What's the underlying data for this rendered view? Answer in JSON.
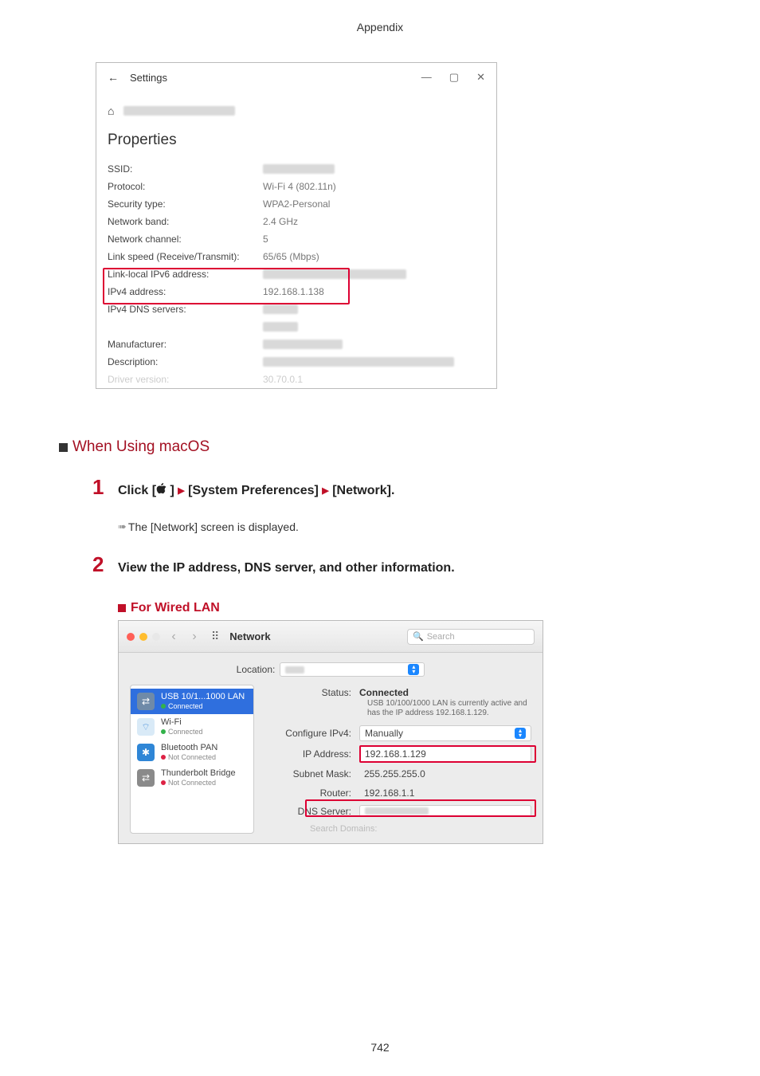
{
  "page": {
    "header": "Appendix",
    "number": "742"
  },
  "win": {
    "title": "Settings",
    "heading": "Properties",
    "rows": {
      "ssid": "SSID:",
      "protocol_l": "Protocol:",
      "protocol_v": "Wi-Fi 4 (802.11n)",
      "sec_l": "Security type:",
      "sec_v": "WPA2-Personal",
      "band_l": "Network band:",
      "band_v": "2.4 GHz",
      "chan_l": "Network channel:",
      "chan_v": "5",
      "link_l": "Link speed (Receive/Transmit):",
      "link_v": "65/65 (Mbps)",
      "llv6_l": "Link-local IPv6 address:",
      "ipv4_l": "IPv4 address:",
      "ipv4_v": "192.168.1.138",
      "dns_l": "IPv4 DNS servers:",
      "manu_l": "Manufacturer:",
      "desc_l": "Description:",
      "drv_l": "Driver version:",
      "drv_v": "30.70.0.1"
    }
  },
  "sections": {
    "macos_heading": "When Using macOS",
    "step1": {
      "pre": "Click [",
      "mid1": "[System Preferences]",
      "mid2": "[Network].",
      "close": "]"
    },
    "note1": "The [Network] screen is displayed.",
    "step2": "View the IP address, DNS server, and other information.",
    "wired_heading": "For Wired LAN"
  },
  "mac": {
    "title": "Network",
    "search_ph": "Search",
    "location_label": "Location:",
    "side": [
      {
        "name": "USB 10/1...1000 LAN",
        "sub": "Connected",
        "dot": "#33b24a"
      },
      {
        "name": "Wi-Fi",
        "sub": "Connected",
        "dot": "#33b24a"
      },
      {
        "name": "Bluetooth PAN",
        "sub": "Not Connected",
        "dot": "#d24"
      },
      {
        "name": "Thunderbolt Bridge",
        "sub": "Not Connected",
        "dot": "#d24"
      }
    ],
    "status_l": "Status:",
    "status_v": "Connected",
    "status_desc": "USB 10/100/1000 LAN is currently active and has the IP address 192.168.1.129.",
    "conf_l": "Configure IPv4:",
    "conf_v": "Manually",
    "ip_l": "IP Address:",
    "ip_v": "192.168.1.129",
    "mask_l": "Subnet Mask:",
    "mask_v": "255.255.255.0",
    "router_l": "Router:",
    "router_v": "192.168.1.1",
    "dns_l": "DNS Server:",
    "srch_dom": "Search Domains:"
  }
}
